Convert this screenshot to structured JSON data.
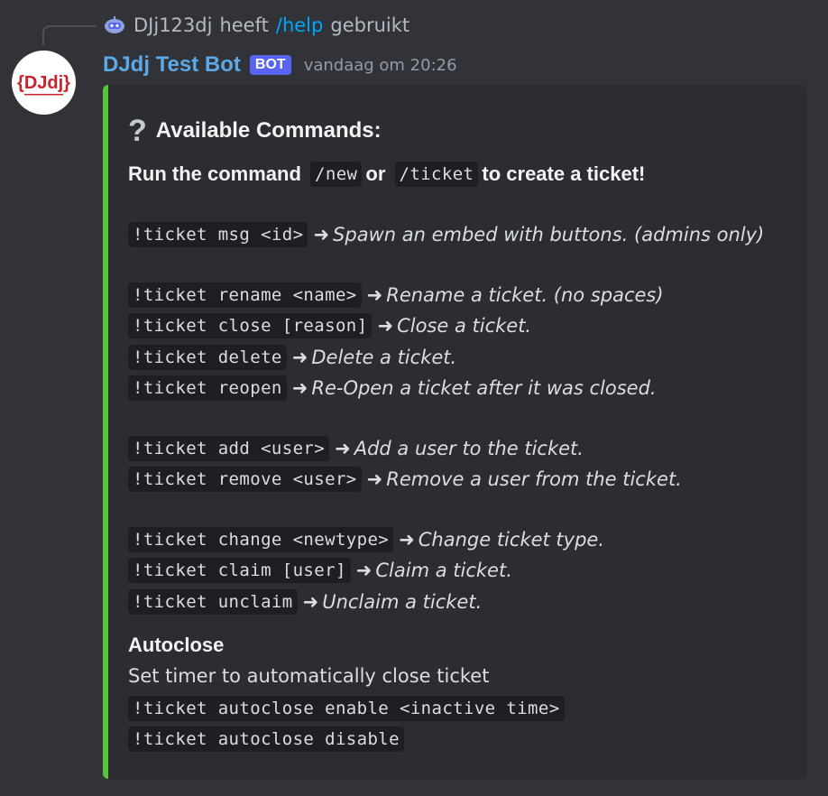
{
  "reply": {
    "user": "DJj123dj",
    "verb": "heeft",
    "command": "/help",
    "suffix": "gebruikt"
  },
  "message": {
    "author": "DJdj Test Bot",
    "badge": "BOT",
    "timestamp": "vandaag om 20:26",
    "avatar_text": "{DJdj}"
  },
  "embed": {
    "accent_color": "#57c43a",
    "title_icon": "?",
    "title": "Available Commands:",
    "intro": {
      "before": "Run the command",
      "code1": "/new",
      "middle": "or",
      "code2": "/ticket",
      "after": "to create a ticket!"
    },
    "arrow": "➜",
    "commands": [
      {
        "code": "!ticket msg <id>",
        "desc": "Spawn an embed with buttons. (admins only)"
      },
      {
        "code": "!ticket rename <name>",
        "desc": "Rename a ticket. (no spaces)"
      },
      {
        "code": "!ticket close [reason]",
        "desc": "Close a ticket."
      },
      {
        "code": "!ticket delete",
        "desc": "Delete a ticket."
      },
      {
        "code": "!ticket reopen",
        "desc": "Re-Open a ticket after it was closed."
      },
      {
        "code": "!ticket add <user>",
        "desc": "Add a user to the ticket."
      },
      {
        "code": "!ticket remove <user>",
        "desc": "Remove a user from the ticket."
      },
      {
        "code": "!ticket change <newtype>",
        "desc": "Change ticket type."
      },
      {
        "code": "!ticket claim [user]",
        "desc": "Claim a ticket."
      },
      {
        "code": "!ticket unclaim",
        "desc": "Unclaim a ticket."
      }
    ],
    "autoclose": {
      "heading": "Autoclose",
      "text": "Set timer to automatically close ticket",
      "code1": "!ticket autoclose enable <inactive time>",
      "code2": "!ticket autoclose disable"
    }
  }
}
